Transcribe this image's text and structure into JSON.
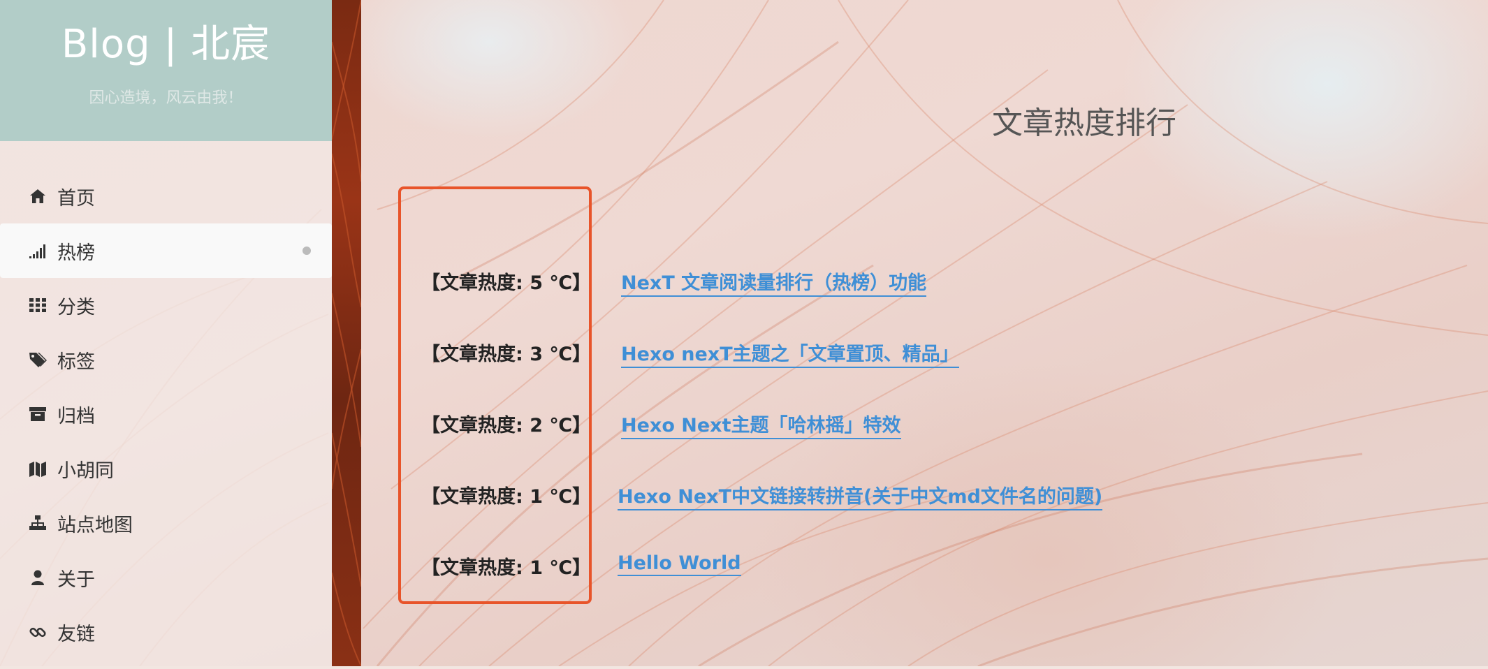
{
  "brand": {
    "title": "Blog | 北宸",
    "subtitle": "因心造境，风云由我！"
  },
  "menu": {
    "items": [
      {
        "label": "首页",
        "icon": "home-icon"
      },
      {
        "label": "热榜",
        "icon": "signal-icon",
        "active": true
      },
      {
        "label": "分类",
        "icon": "grid-icon"
      },
      {
        "label": "标签",
        "icon": "tags-icon"
      },
      {
        "label": "归档",
        "icon": "archive-icon"
      },
      {
        "label": "小胡同",
        "icon": "map-icon"
      },
      {
        "label": "站点地图",
        "icon": "sitemap-icon"
      },
      {
        "label": "关于",
        "icon": "user-icon"
      },
      {
        "label": "友链",
        "icon": "link-icon"
      }
    ]
  },
  "main": {
    "title": "文章热度排行",
    "rankings": [
      {
        "heat": "【文章热度: 5 ℃】",
        "post": "NexT 文章阅读量排行（热榜）功能"
      },
      {
        "heat": "【文章热度: 3 ℃】",
        "post": "Hexo nexT主题之「文章置顶、精品」"
      },
      {
        "heat": "【文章热度: 2 ℃】",
        "post": "Hexo Next主题「哈林摇」特效"
      },
      {
        "heat": "【文章热度: 1 ℃】",
        "post": "Hexo NexT中文链接转拼音(关于中文md文件名的问题)"
      },
      {
        "heat": "【文章热度: 1 ℃】",
        "post": "Hello World"
      }
    ]
  },
  "colors": {
    "brand_bg": "#b2cdc8",
    "link": "#3f8fd6",
    "highlight_border": "#e8542a"
  }
}
